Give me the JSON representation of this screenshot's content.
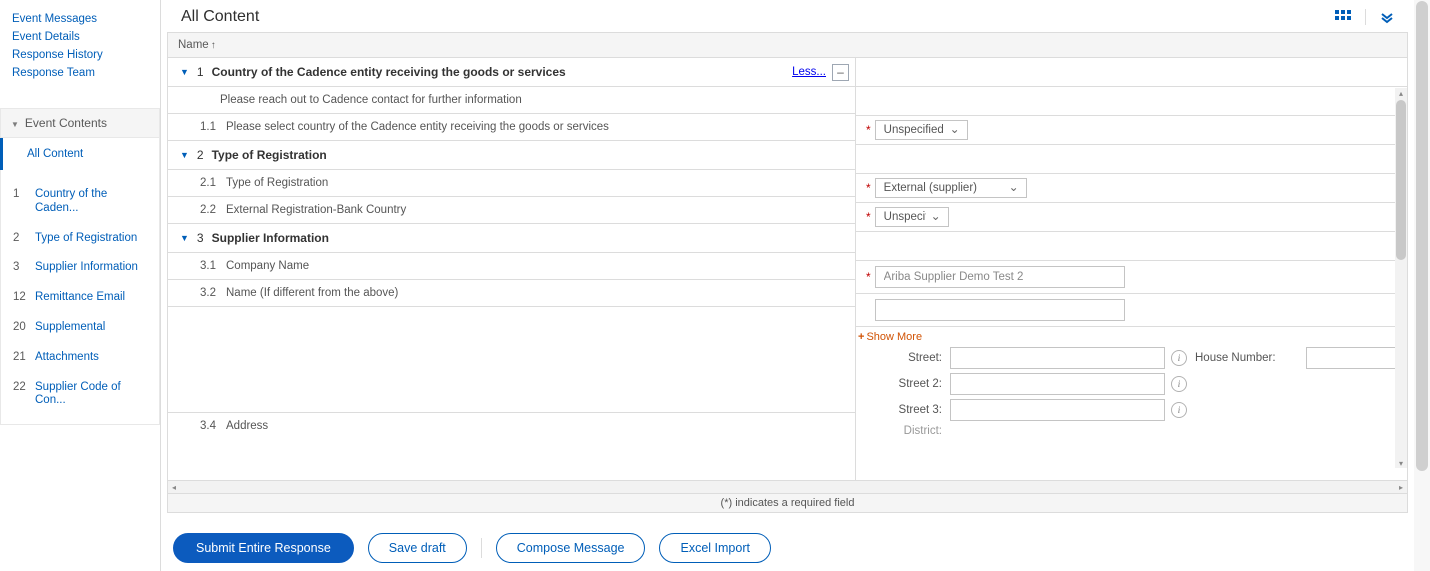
{
  "left_links": [
    "Event Messages",
    "Event Details",
    "Response History",
    "Response Team"
  ],
  "event_contents": {
    "header": "Event Contents",
    "active": "All Content",
    "toc": [
      {
        "num": "1",
        "label": "Country of the Caden..."
      },
      {
        "num": "2",
        "label": "Type of Registration"
      },
      {
        "num": "3",
        "label": "Supplier Information"
      },
      {
        "num": "12",
        "label": "Remittance Email"
      },
      {
        "num": "20",
        "label": "Supplemental"
      },
      {
        "num": "21",
        "label": "Attachments"
      },
      {
        "num": "22",
        "label": "Supplier Code of Con..."
      }
    ]
  },
  "page_title": "All Content",
  "table": {
    "header_name": "Name",
    "less_link": "Less...",
    "s1": {
      "num": "1",
      "title": "Country of the Cadence entity receiving the goods or services"
    },
    "s1_info": "Please reach out to Cadence contact for further information",
    "s1_i1": {
      "num": "1.1",
      "label": "Please select country of the Cadence entity receiving the goods or services",
      "value": "Unspecified"
    },
    "s2": {
      "num": "2",
      "title": "Type of Registration"
    },
    "s2_i1": {
      "num": "2.1",
      "label": "Type of Registration",
      "value": "External (supplier)"
    },
    "s2_i2": {
      "num": "2.2",
      "label": "External Registration-Bank Country",
      "value": "Unspecified"
    },
    "s3": {
      "num": "3",
      "title": "Supplier Information"
    },
    "s3_i1": {
      "num": "3.1",
      "label": "Company Name",
      "value": "Ariba Supplier Demo Test 2"
    },
    "s3_i2": {
      "num": "3.2",
      "label": "Name (If different from the above)",
      "value": ""
    },
    "show_more": "Show More",
    "s3_i4": {
      "num": "3.4",
      "label": "Address"
    },
    "addr": {
      "street_lbl": "Street:",
      "house_lbl": "House Number:",
      "street2_lbl": "Street 2:",
      "street3_lbl": "Street 3:",
      "district_lbl": "District:"
    }
  },
  "footer_note": "(*) indicates a required field",
  "buttons": {
    "submit": "Submit Entire Response",
    "save": "Save draft",
    "compose": "Compose Message",
    "excel": "Excel Import"
  }
}
